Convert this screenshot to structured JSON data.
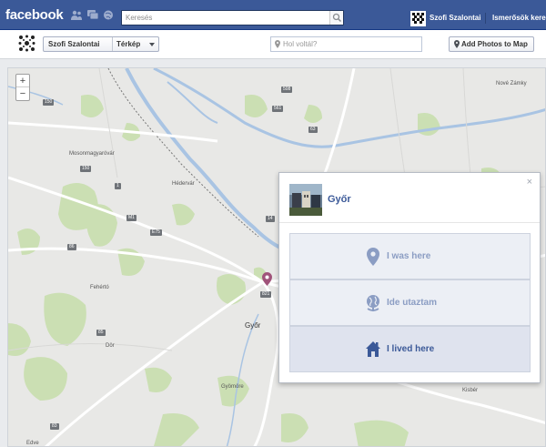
{
  "topbar": {
    "logo": "facebook",
    "search_placeholder": "Keresés",
    "profile_name": "Szofi Szalontai",
    "friends_link": "Ismerősök kere",
    "icons": [
      "friends-icon",
      "messages-icon",
      "notifications-icon",
      "search-icon"
    ]
  },
  "subbar": {
    "name": "Szofi Szalontai",
    "view": "Térkép",
    "where_placeholder": "Hol voltál?",
    "add_photos": "Add Photos to Map"
  },
  "map": {
    "zoom_in": "+",
    "zoom_out": "−",
    "labels": {
      "mosonmagyarovar": "Mosonmagyaróvár",
      "hedervar": "Hédervár",
      "feherto": "Fehértó",
      "gyor": "Győr",
      "dor": "Dör",
      "gyomore": "Gyömöre",
      "edve": "Edve",
      "kisber": "Kisbér",
      "nove_zamky": "Nové Zámky"
    },
    "shields": {
      "s1": "1",
      "s85": "85",
      "s86": "86",
      "m1": "M1",
      "e75": "E75",
      "s14": "14",
      "s63": "63",
      "s508": "508",
      "s561": "561",
      "s83": "83",
      "s13": "13",
      "s82": "82",
      "s150": "150",
      "s813": "813",
      "s821": "821",
      "s818": "818"
    },
    "colors": {
      "water": "#a9c4e3",
      "green": "#c8dfae",
      "road": "#ffffff",
      "land": "#e8e8e6"
    }
  },
  "popup": {
    "close": "×",
    "place": "Győr",
    "options": [
      {
        "label": "I was here",
        "icon": "map-pin-icon"
      },
      {
        "label": "Ide utaztam",
        "icon": "globe-icon"
      },
      {
        "label": "I lived here",
        "icon": "home-icon"
      }
    ]
  }
}
